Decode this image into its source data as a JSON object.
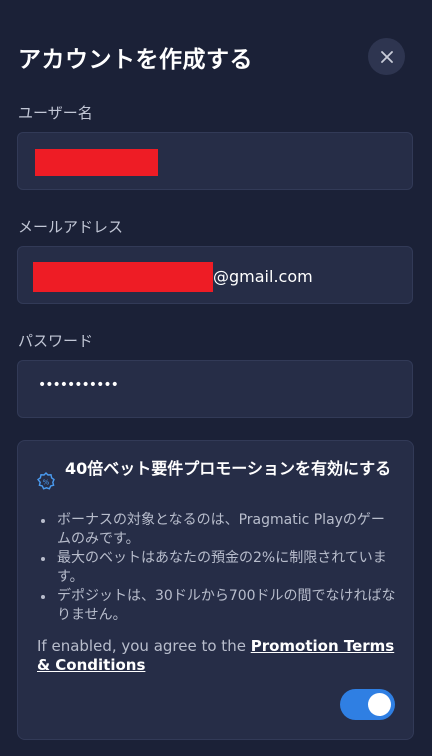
{
  "modal": {
    "title": "アカウントを作成する",
    "close_icon": "close-icon"
  },
  "form": {
    "username": {
      "label": "ユーザー名",
      "value": ""
    },
    "email": {
      "label": "メールアドレス",
      "value_suffix": "@gmail.com"
    },
    "password": {
      "label": "パスワード",
      "value": "•••••••••••"
    }
  },
  "promotion": {
    "icon": "percent-badge-icon",
    "title": "40倍ベット要件プロモーションを有効にする",
    "bullets": [
      "ボーナスの対象となるのは、Pragmatic Playのゲームのみです。",
      "最大のベットはあなたの預金の2%に制限されています。",
      "デポジットは、30ドルから700ドルの間でなければなりません。"
    ],
    "agree_prefix": "If enabled, you agree to the ",
    "terms_link": "Promotion Terms & Conditions",
    "toggle_on": true
  },
  "colors": {
    "background": "#1b2137",
    "field_bg": "#262d47",
    "accent": "#2f7fe3",
    "redaction": "#ee1c25"
  }
}
